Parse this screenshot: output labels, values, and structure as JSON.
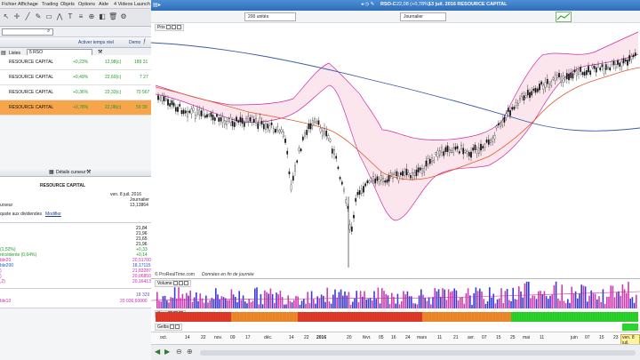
{
  "menu": [
    "Fichier",
    "Affichage",
    "Trading",
    "Objets",
    "Options",
    "Aide",
    "4 Videos Launch"
  ],
  "watchlist": {
    "search_value": "",
    "realtime_label": "Activer temps réel",
    "demo_label": "Demo",
    "lists_label": "Listes",
    "list_name": "5 RSO",
    "columns": [
      "Nom",
      "% Var.",
      "Dernier",
      "Volu"
    ],
    "rows": [
      {
        "name": "RESOURCE CAPITAL",
        "var": "+0,23%",
        "last": "12,98(c)",
        "vol": "189 31"
      },
      {
        "name": "RESOURCE CAPITAL",
        "var": "+0,49%",
        "last": "22,60(c)",
        "vol": "7 27"
      },
      {
        "name": "RESOURCE CAPITAL",
        "var": "+0,36%",
        "last": "22,33(c)",
        "vol": "70 567"
      },
      {
        "name": "RESOURCE CAPITAL",
        "var": "+0,78%",
        "last": "22,08(c)",
        "vol": "59 30"
      }
    ]
  },
  "details": {
    "header": "Détails curseur",
    "title": "RESOURCE CAPITAL",
    "date": "ven. 8 juil. 2016",
    "period": "Journalier",
    "price": "13,13864",
    "cursor_label": "urseur",
    "dividend_label": "quste aux dividendes",
    "dividend_link": "Modifier"
  },
  "indicators": [
    {
      "label": "",
      "value": "21,84",
      "color": "#222222"
    },
    {
      "label": "",
      "value": "21,96",
      "color": "#222222"
    },
    {
      "label": "",
      "value": "21,65",
      "color": "#222222"
    },
    {
      "label": "",
      "value": "21,96",
      "color": "#222222"
    },
    {
      "label": "(1,52%)",
      "value": "+0,33",
      "color": "#1f9a2a"
    },
    {
      "label": "récédente (0,64%)",
      "value": "+0,14",
      "color": "#1f9a2a"
    },
    {
      "label": "ble20",
      "value": "20,51700",
      "color": "#cc2aa8"
    },
    {
      "label": "ble200",
      "value": "18,17115",
      "color": "#2255cc"
    },
    {
      "label": ")",
      "value": "21,83287",
      "color": "#cc2aa8"
    },
    {
      "label": ")",
      "value": "20,06850",
      "color": "#cc2aa8"
    },
    {
      "label": ",2)",
      "value": "20,16413",
      "color": "#cc2aa8"
    }
  ],
  "volume_values": [
    {
      "label": "",
      "value": "18 329",
      "color": "#6655cc"
    },
    {
      "label": "ble10",
      "value": "20 036,60000",
      "color": "#cc2aa8"
    }
  ],
  "chart": {
    "symbol": "RSO-C",
    "price_line": "22,08 (+0,78%)",
    "date_line": "13 juil. 2016 RESOURCE CAPITAL",
    "units_select": "200 unités",
    "period_select": "Journalier",
    "price_panel_label": "Prix",
    "volume_panel_label": "Volume",
    "zone_panel_label": "Zone",
    "gelbs_panel_label": "Gelbs",
    "source_text": "© ProRealTime.com",
    "source_note": "Données en fin de journée",
    "xaxis_labels": [
      "oct.",
      "14",
      "22",
      "nov.",
      "09",
      "17",
      "déc.",
      "14",
      "22",
      "2016",
      "20",
      "févr.",
      "05",
      "16",
      "24",
      "mars",
      "11",
      "21",
      "avr.",
      "07",
      "15",
      "25",
      "mai",
      "11",
      "juin",
      "07",
      "15",
      "23"
    ],
    "xaxis_end_label": "ven. 8 juil."
  }
}
